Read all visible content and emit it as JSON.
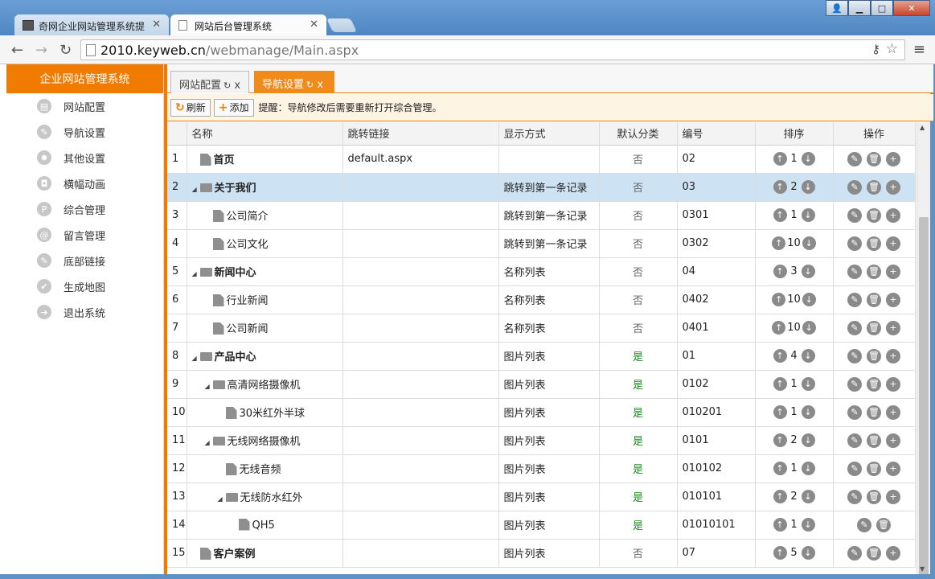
{
  "browser": {
    "tabs": [
      {
        "label": "奇网企业网站管理系统提"
      },
      {
        "label": "网站后台管理系统"
      }
    ],
    "url": {
      "host": "2010.keyweb.cn",
      "path": "/webmanage/Main.aspx"
    },
    "win": {
      "min": "▁",
      "max": "□",
      "close": "✕"
    }
  },
  "sidebar": {
    "title": "企业网站管理系统",
    "items": [
      {
        "label": "网站配置",
        "icon": "config-icon",
        "glyph": "▤"
      },
      {
        "label": "导航设置",
        "icon": "nav-icon",
        "glyph": "✎"
      },
      {
        "label": "其他设置",
        "icon": "gear-icon",
        "glyph": "✹"
      },
      {
        "label": "横幅动画",
        "icon": "camera-icon",
        "glyph": "◘"
      },
      {
        "label": "综合管理",
        "icon": "p-icon",
        "glyph": "P"
      },
      {
        "label": "留言管理",
        "icon": "at-icon",
        "glyph": "@"
      },
      {
        "label": "底部链接",
        "icon": "link-icon",
        "glyph": "✎"
      },
      {
        "label": "生成地图",
        "icon": "check-icon",
        "glyph": "✔"
      },
      {
        "label": "退出系统",
        "icon": "exit-icon",
        "glyph": "➔"
      }
    ]
  },
  "panel_tabs": [
    {
      "label": "网站配置"
    },
    {
      "label": "导航设置"
    }
  ],
  "actions": {
    "refresh": "刷新",
    "add": "添加",
    "tip": "提醒：导航修改后需要重新打开综合管理。"
  },
  "columns": {
    "name": "名称",
    "link": "跳转链接",
    "display": "显示方式",
    "default": "默认分类",
    "code": "编号",
    "sort": "排序",
    "ops": "操作"
  },
  "rows": [
    {
      "idx": "1",
      "level": 0,
      "type": "doc",
      "bold": true,
      "name": "首页",
      "link": "default.aspx",
      "display": "",
      "default": "否",
      "code": "02",
      "rank": "1",
      "ops": 3
    },
    {
      "idx": "2",
      "level": 0,
      "type": "folder",
      "bold": true,
      "name": "关于我们",
      "link": "",
      "display": "跳转到第一条记录",
      "default": "否",
      "code": "03",
      "rank": "2",
      "ops": 3,
      "selected": true
    },
    {
      "idx": "3",
      "level": 1,
      "type": "doc",
      "bold": false,
      "name": "公司简介",
      "link": "",
      "display": "跳转到第一条记录",
      "default": "否",
      "code": "0301",
      "rank": "1",
      "ops": 3
    },
    {
      "idx": "4",
      "level": 1,
      "type": "doc",
      "bold": false,
      "name": "公司文化",
      "link": "",
      "display": "跳转到第一条记录",
      "default": "否",
      "code": "0302",
      "rank": "10",
      "ops": 3
    },
    {
      "idx": "5",
      "level": 0,
      "type": "folder",
      "bold": true,
      "name": "新闻中心",
      "link": "",
      "display": "名称列表",
      "default": "否",
      "code": "04",
      "rank": "3",
      "ops": 3
    },
    {
      "idx": "6",
      "level": 1,
      "type": "doc",
      "bold": false,
      "name": "行业新闻",
      "link": "",
      "display": "名称列表",
      "default": "否",
      "code": "0402",
      "rank": "10",
      "ops": 3
    },
    {
      "idx": "7",
      "level": 1,
      "type": "doc",
      "bold": false,
      "name": "公司新闻",
      "link": "",
      "display": "名称列表",
      "default": "否",
      "code": "0401",
      "rank": "10",
      "ops": 3
    },
    {
      "idx": "8",
      "level": 0,
      "type": "folder",
      "bold": true,
      "name": "产品中心",
      "link": "",
      "display": "图片列表",
      "default": "是",
      "code": "01",
      "rank": "4",
      "ops": 3
    },
    {
      "idx": "9",
      "level": 1,
      "type": "folder",
      "bold": false,
      "name": "高清网络摄像机",
      "link": "",
      "display": "图片列表",
      "default": "是",
      "code": "0102",
      "rank": "1",
      "ops": 3
    },
    {
      "idx": "10",
      "level": 2,
      "type": "doc",
      "bold": false,
      "name": "30米红外半球",
      "link": "",
      "display": "图片列表",
      "default": "是",
      "code": "010201",
      "rank": "1",
      "ops": 3
    },
    {
      "idx": "11",
      "level": 1,
      "type": "folder",
      "bold": false,
      "name": "无线网络摄像机",
      "link": "",
      "display": "图片列表",
      "default": "是",
      "code": "0101",
      "rank": "2",
      "ops": 3
    },
    {
      "idx": "12",
      "level": 2,
      "type": "doc",
      "bold": false,
      "name": "无线音频",
      "link": "",
      "display": "图片列表",
      "default": "是",
      "code": "010102",
      "rank": "1",
      "ops": 3
    },
    {
      "idx": "13",
      "level": 2,
      "type": "folder",
      "bold": false,
      "name": "无线防水红外",
      "link": "",
      "display": "图片列表",
      "default": "是",
      "code": "010101",
      "rank": "2",
      "ops": 3
    },
    {
      "idx": "14",
      "level": 3,
      "type": "doc",
      "bold": false,
      "name": "QH5",
      "link": "",
      "display": "图片列表",
      "default": "是",
      "code": "01010101",
      "rank": "1",
      "ops": 2
    },
    {
      "idx": "15",
      "level": 0,
      "type": "doc",
      "bold": true,
      "name": "客户案例",
      "link": "",
      "display": "图片列表",
      "default": "否",
      "code": "07",
      "rank": "5",
      "ops": 3
    }
  ]
}
